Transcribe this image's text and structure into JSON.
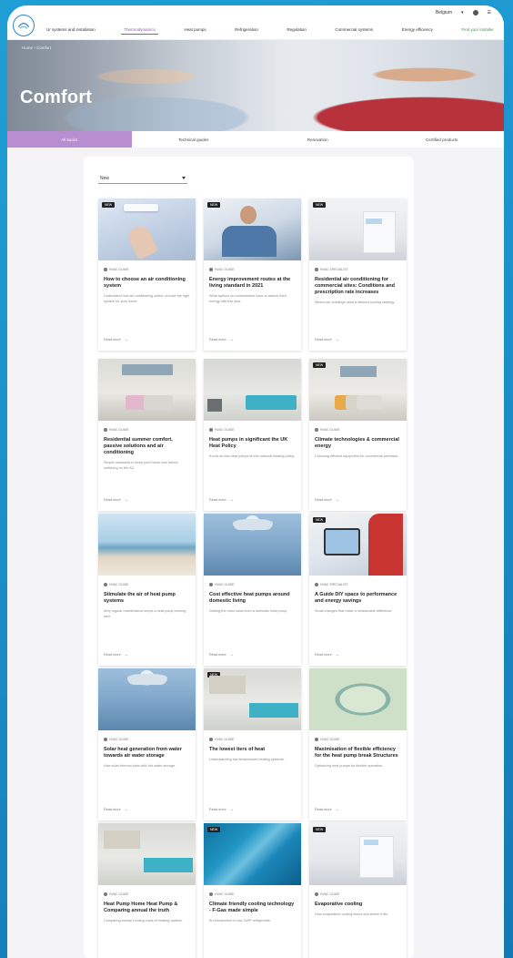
{
  "utility": {
    "region_label": "Belgium",
    "icons": [
      "user-icon",
      "menu-icon"
    ]
  },
  "nav": {
    "items": [
      {
        "label": "Ur systems and installation",
        "active": false
      },
      {
        "label": "Thermodynamics",
        "active": true
      },
      {
        "label": "Heat pumps",
        "active": false
      },
      {
        "label": "Refrigeration",
        "active": false
      },
      {
        "label": "Regulation",
        "active": false
      },
      {
        "label": "Commercial systems",
        "active": false
      },
      {
        "label": "Energy efficiency",
        "active": false
      },
      {
        "label": "Find your installer",
        "active": false,
        "accent": "#3b9a4a"
      }
    ]
  },
  "hero": {
    "breadcrumb": "Home › Comfort",
    "title": "Comfort"
  },
  "tabs": [
    {
      "label": "All topics",
      "active": true
    },
    {
      "label": "Technical guides"
    },
    {
      "label": "Renovation"
    },
    {
      "label": "Certified products"
    }
  ],
  "sort": {
    "label": "New"
  },
  "cards": [
    {
      "img": "remote",
      "badge": "NEW",
      "meta": "HVAC GUIDE",
      "title": "How to choose an air conditioning system",
      "excerpt": "Understand how air conditioning works, choose the right system for your home.",
      "more": "Read more"
    },
    {
      "img": "man",
      "badge": "NEW",
      "meta": "HVAC GUIDE",
      "title": "Energy improvement routes at the living standard in 2021",
      "excerpt": "What options do homeowners have to reduce their energy bills this year.",
      "more": "Read more"
    },
    {
      "img": "room",
      "badge": "NEW",
      "meta": "HVAC SPECIALIST",
      "title": "Residential air conditioning for commercial sites: Conditions and prescription rate increases",
      "excerpt": "Mixed-use buildings need a tailored cooling strategy.",
      "more": "Read more"
    },
    {
      "img": "sofa",
      "badge": "",
      "meta": "HVAC GUIDE",
      "title": "Residential summer comfort, passive solutions and air conditioning",
      "excerpt": "Simple measures to keep your home cool before switching on the AC.",
      "more": "Read more"
    },
    {
      "img": "bed",
      "badge": "",
      "meta": "HVAC GUIDE",
      "title": "Heat pumps in significant the UK Heat Policy",
      "excerpt": "A look at how heat pumps fit into national heating policy.",
      "more": "Read more"
    },
    {
      "img": "sofa2",
      "badge": "NEW",
      "meta": "HVAC GUIDE",
      "title": "Climate technologies & commercial energy",
      "excerpt": "Choosing efficient equipment for commercial premises.",
      "more": "Read more"
    },
    {
      "img": "sea",
      "badge": "",
      "meta": "HVAC GUIDE",
      "title": "Stimulate the air of heat pump systems",
      "excerpt": "Why regular maintenance keeps a heat pump running well.",
      "more": "Read more"
    },
    {
      "img": "shower",
      "badge": "",
      "meta": "HVAC GUIDE",
      "title": "Cost effective heat pumps around domestic living",
      "excerpt": "Getting the most value from a domestic heat pump.",
      "more": "Read more"
    },
    {
      "img": "tablet",
      "badge": "NEW",
      "meta": "HVAC SPECIALIST",
      "title": "A Guide DIY space to performance and energy savings",
      "excerpt": "Small changes that make a measurable difference.",
      "more": "Read more"
    },
    {
      "img": "shower",
      "badge": "",
      "meta": "HVAC GUIDE",
      "title": "Solar heat generation from water towards air water storage",
      "excerpt": "How solar thermal pairs with hot water storage.",
      "more": "Read more"
    },
    {
      "img": "bed2",
      "badge": "NEW",
      "meta": "HVAC GUIDE",
      "title": "The lowest tiers of heat",
      "excerpt": "Understanding low-temperature heating systems.",
      "more": "Read more"
    },
    {
      "img": "map",
      "badge": "",
      "meta": "HVAC GUIDE",
      "title": "Maximisation of flexible efficiency for the heat pump break Structures",
      "excerpt": "Optimising heat pumps for flexible operation.",
      "more": "Read more"
    },
    {
      "img": "bed2",
      "badge": "",
      "meta": "HVAC GUIDE",
      "title": "Heat Pump Home Heat Pump & Comparing annual the truth",
      "excerpt": "Comparing annual running costs of heating options.",
      "more": "Read more"
    },
    {
      "img": "ice",
      "badge": "NEW",
      "meta": "HVAC GUIDE",
      "title": "Climate friendly cooling technology - F-Gas made simple",
      "excerpt": "An introduction to low-GWP refrigerants.",
      "more": "Read more"
    },
    {
      "img": "room2",
      "badge": "NEW",
      "meta": "HVAC GUIDE",
      "title": "Evaporative cooling",
      "excerpt": "How evaporative cooling works and where it fits.",
      "more": "Read more"
    }
  ]
}
